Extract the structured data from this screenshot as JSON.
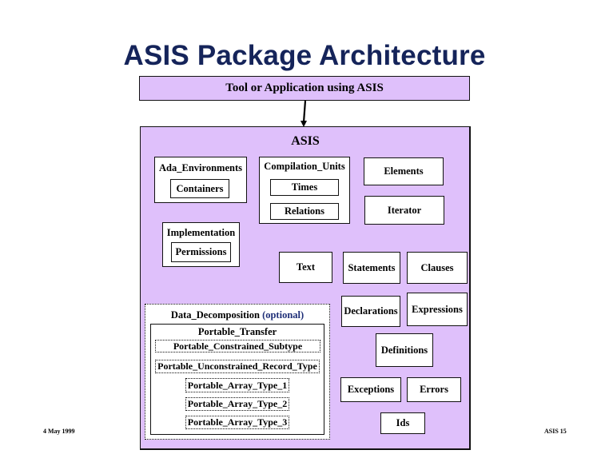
{
  "title": "ASIS Package Architecture",
  "tool_box": {
    "label": "Tool or Application using ASIS"
  },
  "asis_box": {
    "label": "ASIS"
  },
  "packages": {
    "ada_environments": {
      "label": "Ada_Environments",
      "children": [
        "Containers"
      ]
    },
    "compilation_units": {
      "label": "Compilation_Units",
      "children": [
        "Times",
        "Relations"
      ]
    },
    "elements": "Elements",
    "iterator": "Iterator",
    "implementation": {
      "label": "Implementation",
      "children": [
        "Permissions"
      ]
    },
    "text": "Text",
    "statements": "Statements",
    "clauses": "Clauses",
    "declarations": "Declarations",
    "expressions": "Expressions",
    "definitions": "Definitions",
    "exceptions": "Exceptions",
    "errors": "Errors",
    "ids": "Ids"
  },
  "data_decomposition": {
    "label": "Data_Decomposition",
    "qualifier": "(optional)",
    "portable_transfer": "Portable_Transfer",
    "items": [
      "Portable_Constrained_Subtype",
      "Portable_Unconstrained_Record_Type",
      "Portable_Array_Type_1",
      "Portable_Array_Type_2",
      "Portable_Array_Type_3"
    ]
  },
  "footer": {
    "date": "4 May 1999",
    "slide": "ASIS 15"
  },
  "colors": {
    "lavender": "#dfc0fb",
    "title": "#15245a"
  }
}
